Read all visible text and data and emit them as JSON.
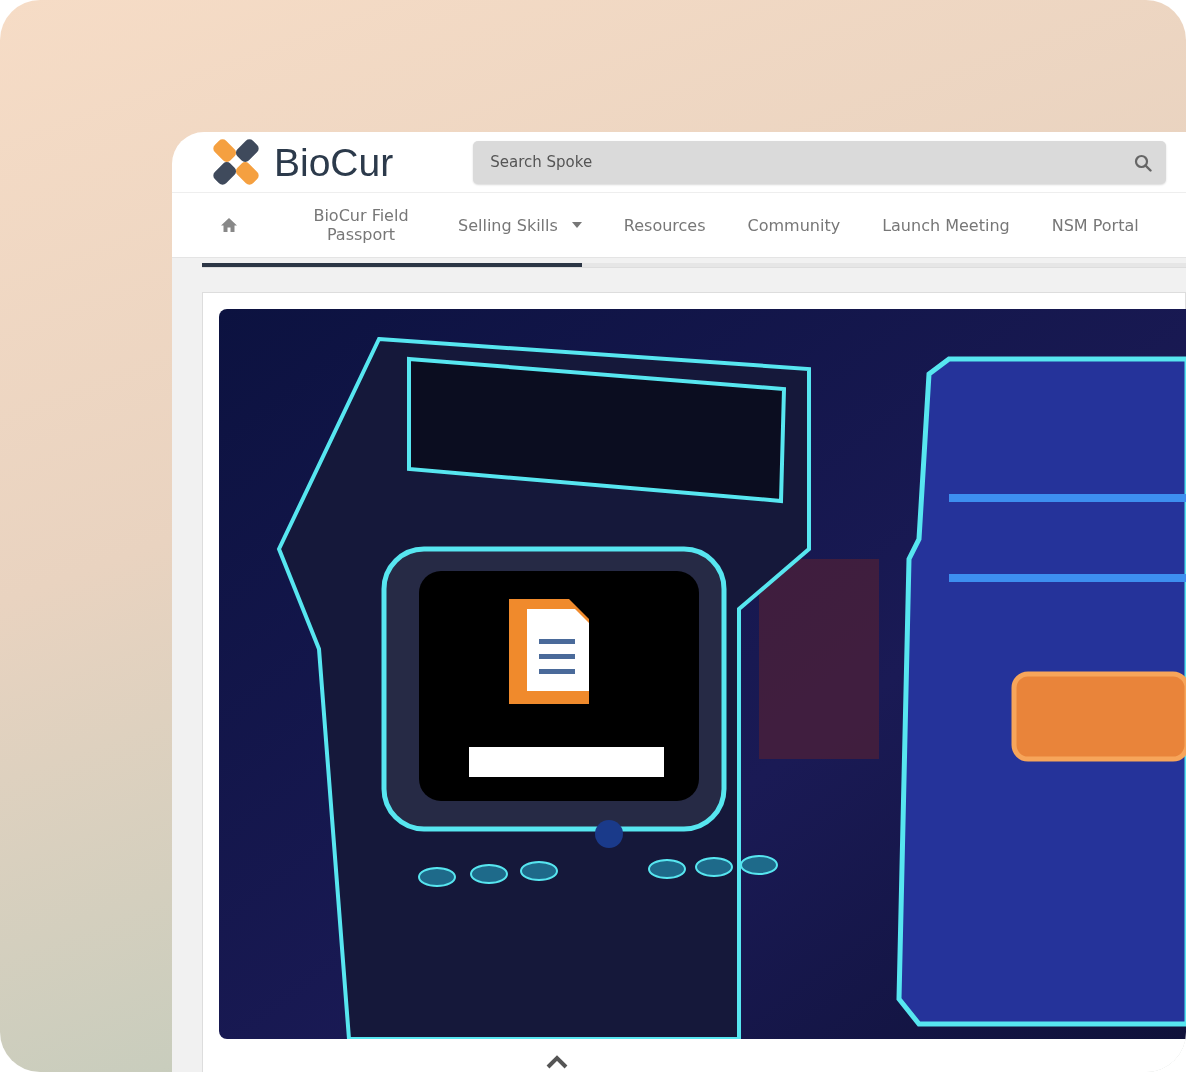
{
  "brand": {
    "name": "BioCur"
  },
  "search": {
    "placeholder": "Search Spoke"
  },
  "nav": {
    "items": [
      {
        "kind": "home"
      },
      {
        "kind": "link",
        "label": "BioCur Field Passport"
      },
      {
        "kind": "dropdown",
        "label": "Selling Skills"
      },
      {
        "kind": "link",
        "label": "Resources"
      },
      {
        "kind": "link",
        "label": "Community"
      },
      {
        "kind": "link",
        "label": "Launch Meeting"
      },
      {
        "kind": "link",
        "label": "NSM Portal"
      }
    ]
  },
  "progress": {
    "level": 0.386
  }
}
